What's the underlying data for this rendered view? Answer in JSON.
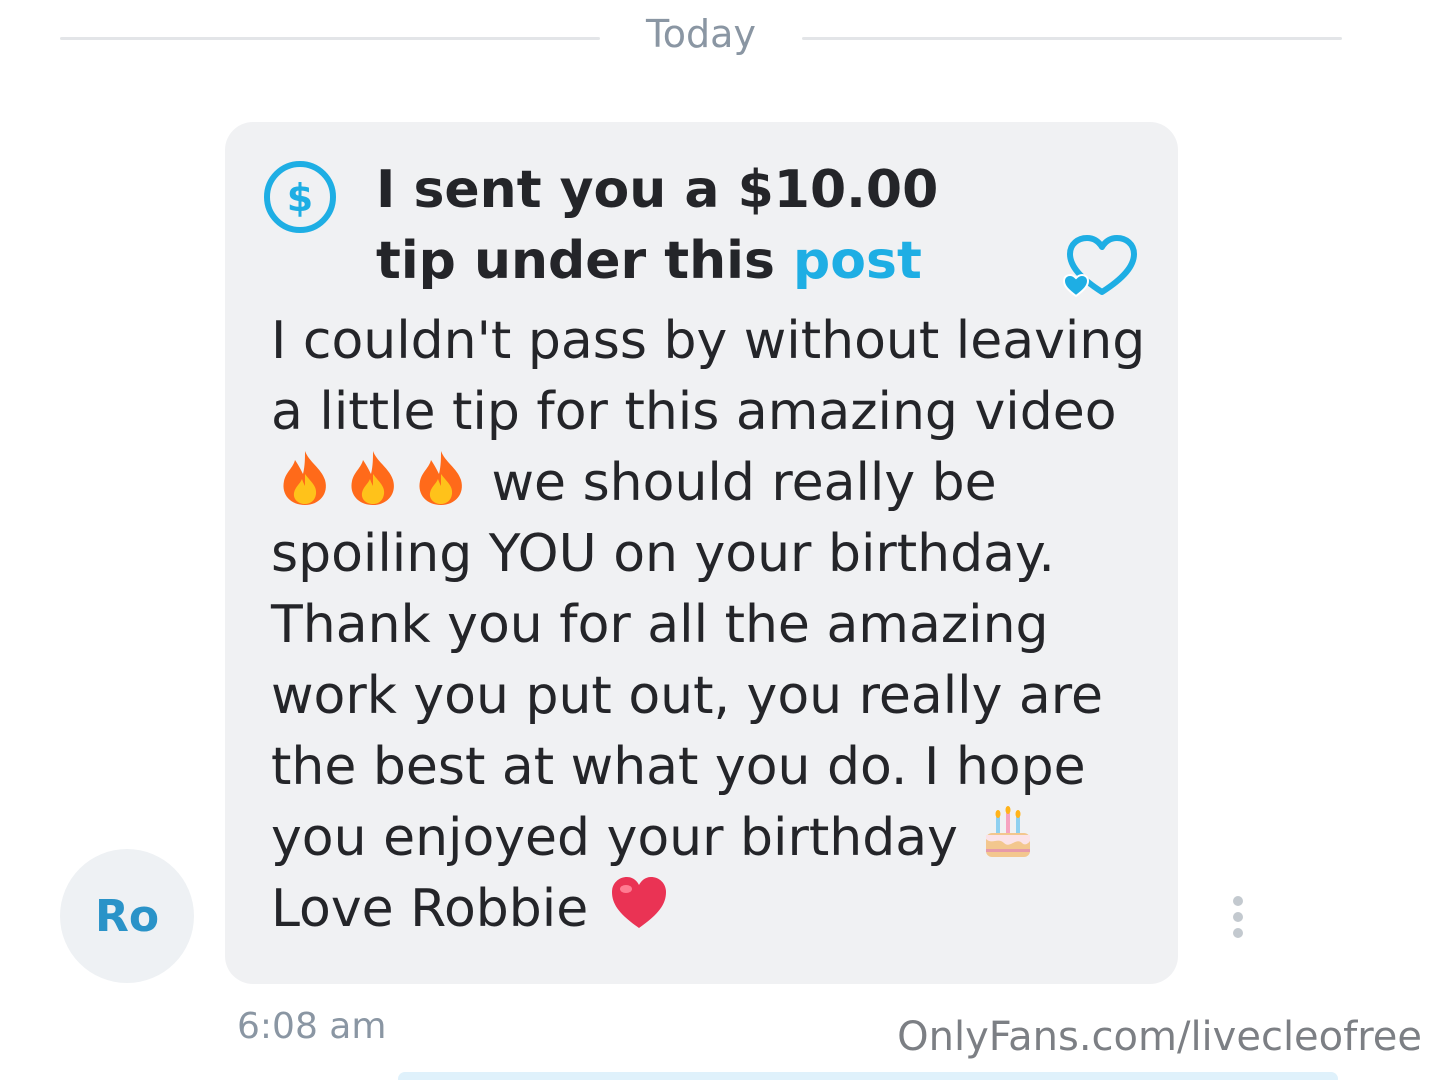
{
  "date_divider": {
    "label": "Today"
  },
  "avatar": {
    "initials": "Ro"
  },
  "tip": {
    "header_prefix": "I sent you a $10.00 tip under this ",
    "link_label": "post"
  },
  "message": {
    "line1": "I couldn't pass by without leaving a little tip for this amazing video ",
    "emoji_fire": [
      "fire-emoji",
      "fire-emoji",
      "fire-emoji"
    ],
    "line2": " we should really be spoiling YOU on your birthday. Thank you for all the amazing work you put out, you really are the best at what you do. I hope you enjoyed your birthday ",
    "emoji_cake": "birthday-cake-emoji",
    "line3": " Love Robbie ",
    "emoji_heart": "red-heart-emoji"
  },
  "timestamp": "6:08 am",
  "watermark": "OnlyFans.com/livecleofree",
  "colors": {
    "accent": "#1eaee4",
    "bubble": "#f0f1f3",
    "text": "#242529",
    "muted": "#8a96a3"
  },
  "icons": {
    "tip": "dollar-circle-icon",
    "like": "heart-outline-icon",
    "more": "more-vertical-icon"
  }
}
